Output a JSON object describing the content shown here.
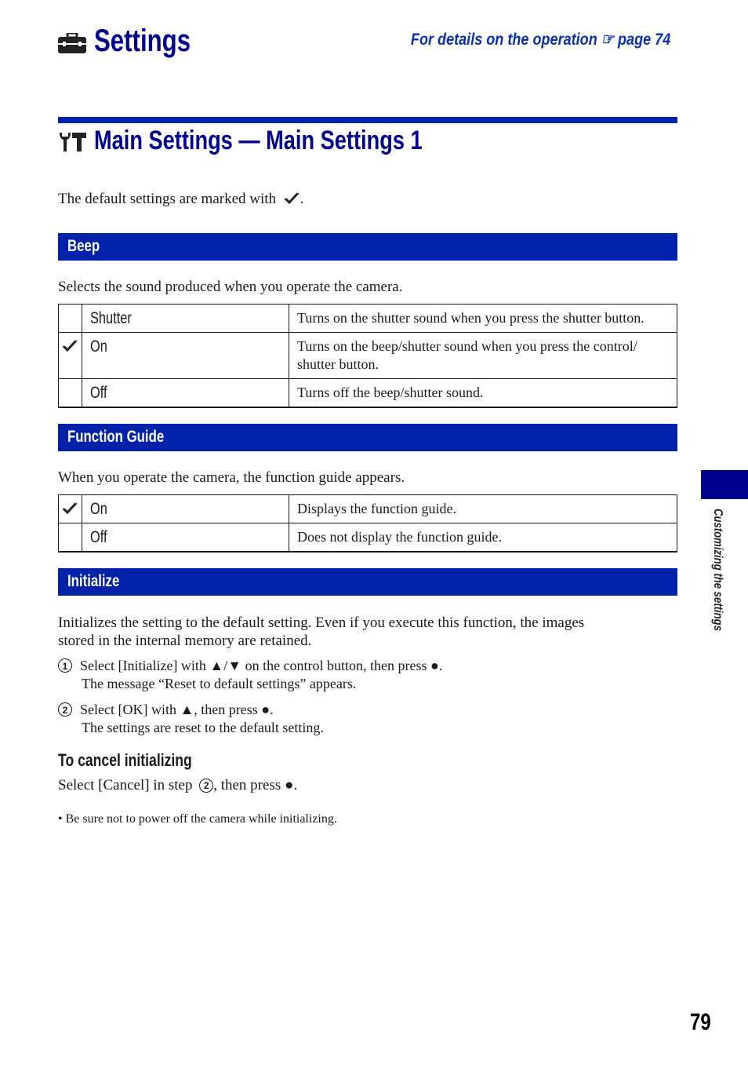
{
  "header": {
    "title": "Settings",
    "title_icon": "toolbox-icon",
    "reference_text": "For details on the operation",
    "reference_icon": "pointing-hand-icon",
    "reference_page": "page 74"
  },
  "section": {
    "title": "Main Settings — Main Settings 1",
    "title_icon": "wrench-hammer-icon",
    "intro": "The default settings are marked with",
    "intro_suffix": ".",
    "default_marker_icon": "checkmark-icon"
  },
  "beep": {
    "heading": "Beep",
    "description": "Selects the sound produced when you operate the camera.",
    "options": [
      {
        "name": "Shutter",
        "default": false,
        "description": "Turns on the shutter sound when you press the shutter button."
      },
      {
        "name": "On",
        "default": true,
        "description": "Turns on the beep/shutter sound when you press the control/ shutter button."
      },
      {
        "name": "Off",
        "default": false,
        "description": "Turns off the beep/shutter sound."
      }
    ]
  },
  "function_guide": {
    "heading": "Function Guide",
    "description": "When you operate the camera, the function guide appears.",
    "options": [
      {
        "name": "On",
        "default": true,
        "description": "Displays the function guide."
      },
      {
        "name": "Off",
        "default": false,
        "description": "Does not display the function guide."
      }
    ]
  },
  "initialize": {
    "heading": "Initialize",
    "description_line1": "Initializes the setting to the default setting. Even if you execute this function, the images",
    "description_line2": "stored in the internal memory are retained.",
    "steps": [
      {
        "number": "1",
        "text": "Select [Initialize] with ▲/▼ on the control button, then press ●.",
        "sub": "The message “Reset to default settings” appears."
      },
      {
        "number": "2",
        "text": "Select [OK] with ▲, then press ●.",
        "sub": "The settings are reset to the default setting."
      }
    ],
    "cancel_heading": "To cancel initializing",
    "cancel_text_before": "Select [Cancel] in step",
    "cancel_step": "2",
    "cancel_text_after": ", then press ●.",
    "note": "•  Be sure not to power off the camera while initializing."
  },
  "side_tab": {
    "label": "Customizing the settings",
    "color": "#00008f"
  },
  "colors": {
    "heading_blue": "#00008f",
    "bar_blue": "#0022aa",
    "link_blue": "#0a2faf"
  },
  "page_number": "79"
}
